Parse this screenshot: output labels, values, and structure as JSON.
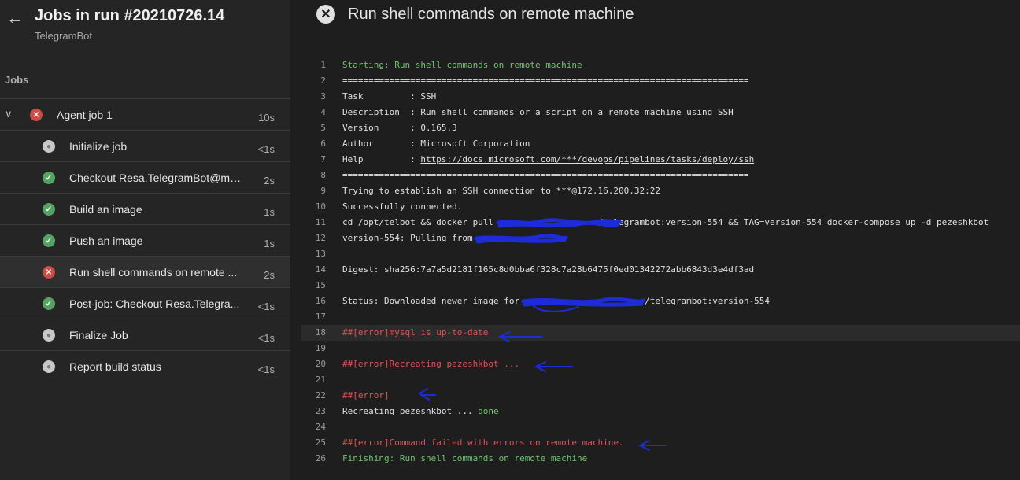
{
  "header": {
    "title": "Jobs in run #20210726.14",
    "subtitle": "TelegramBot"
  },
  "jobs_label": "Jobs",
  "jobs": [
    {
      "label": "Agent job 1",
      "duration": "10s",
      "status": "fail",
      "parent": true
    },
    {
      "label": "Initialize job",
      "duration": "<1s",
      "status": "skip"
    },
    {
      "label": "Checkout Resa.TelegramBot@mas...",
      "duration": "2s",
      "status": "ok"
    },
    {
      "label": "Build an image",
      "duration": "1s",
      "status": "ok"
    },
    {
      "label": "Push an image",
      "duration": "1s",
      "status": "ok"
    },
    {
      "label": "Run shell commands on remote ...",
      "duration": "2s",
      "status": "fail",
      "selected": true
    },
    {
      "label": "Post-job: Checkout Resa.Telegra...",
      "duration": "<1s",
      "status": "ok"
    },
    {
      "label": "Finalize Job",
      "duration": "<1s",
      "status": "skip"
    },
    {
      "label": "Report build status",
      "duration": "<1s",
      "status": "skip"
    }
  ],
  "task": {
    "title": "Run shell commands on remote machine"
  },
  "log": [
    {
      "n": "1",
      "text": "Starting: Run shell commands on remote machine",
      "style": "green"
    },
    {
      "n": "2",
      "text": "==============================================================================",
      "style": ""
    },
    {
      "n": "3",
      "text": "Task         : SSH",
      "style": ""
    },
    {
      "n": "4",
      "text": "Description  : Run shell commands or a script on a remote machine using SSH",
      "style": ""
    },
    {
      "n": "5",
      "text": "Version      : 0.165.3",
      "style": ""
    },
    {
      "n": "6",
      "text": "Author       : Microsoft Corporation",
      "style": ""
    },
    {
      "n": "7",
      "text": "Help         : ",
      "link": "https://docs.microsoft.com/***/devops/pipelines/tasks/deploy/ssh",
      "style": ""
    },
    {
      "n": "8",
      "text": "==============================================================================",
      "style": ""
    },
    {
      "n": "9",
      "text": "Trying to establish an SSH connection to ***@172.16.200.32:22",
      "style": ""
    },
    {
      "n": "10",
      "text": "Successfully connected.",
      "style": ""
    },
    {
      "n": "11",
      "text": "cd /opt/telbot && docker pull                    /telegrambot:version-554 && TAG=version-554 docker-compose up -d pezeshkbot",
      "style": ""
    },
    {
      "n": "12",
      "text": "version-554: Pulling from                  ",
      "style": ""
    },
    {
      "n": "13",
      "text": "",
      "style": ""
    },
    {
      "n": "14",
      "text": "Digest: sha256:7a7a5d2181f165c8d0bba6f328c7a28b6475f0ed01342272abb6843d3e4df3ad",
      "style": ""
    },
    {
      "n": "15",
      "text": "",
      "style": ""
    },
    {
      "n": "16",
      "text": "Status: Downloaded newer image for                        /telegrambot:version-554",
      "style": ""
    },
    {
      "n": "17",
      "text": "",
      "style": ""
    },
    {
      "n": "18",
      "text": "##[error]mysql is up-to-date",
      "style": "red",
      "hl": true
    },
    {
      "n": "19",
      "text": "",
      "style": ""
    },
    {
      "n": "20",
      "text": "##[error]Recreating pezeshkbot ...",
      "style": "red"
    },
    {
      "n": "21",
      "text": "",
      "style": ""
    },
    {
      "n": "22",
      "text": "##[error]",
      "style": "red"
    },
    {
      "n": "23",
      "text": "Recreating pezeshkbot ... ",
      "suffix": "done",
      "style": ""
    },
    {
      "n": "24",
      "text": "",
      "style": ""
    },
    {
      "n": "25",
      "text": "##[error]Command failed with errors on remote machine.",
      "style": "red"
    },
    {
      "n": "26",
      "text": "Finishing: Run shell commands on remote machine",
      "style": "green"
    }
  ],
  "colors": {
    "error": "#e05252",
    "success": "#6ec46e",
    "annotation": "#1d2bd8"
  },
  "icons": {
    "back": "arrow-left-icon",
    "fail": "error-circle-icon",
    "ok": "check-circle-icon",
    "skip": "skipped-circle-icon"
  }
}
